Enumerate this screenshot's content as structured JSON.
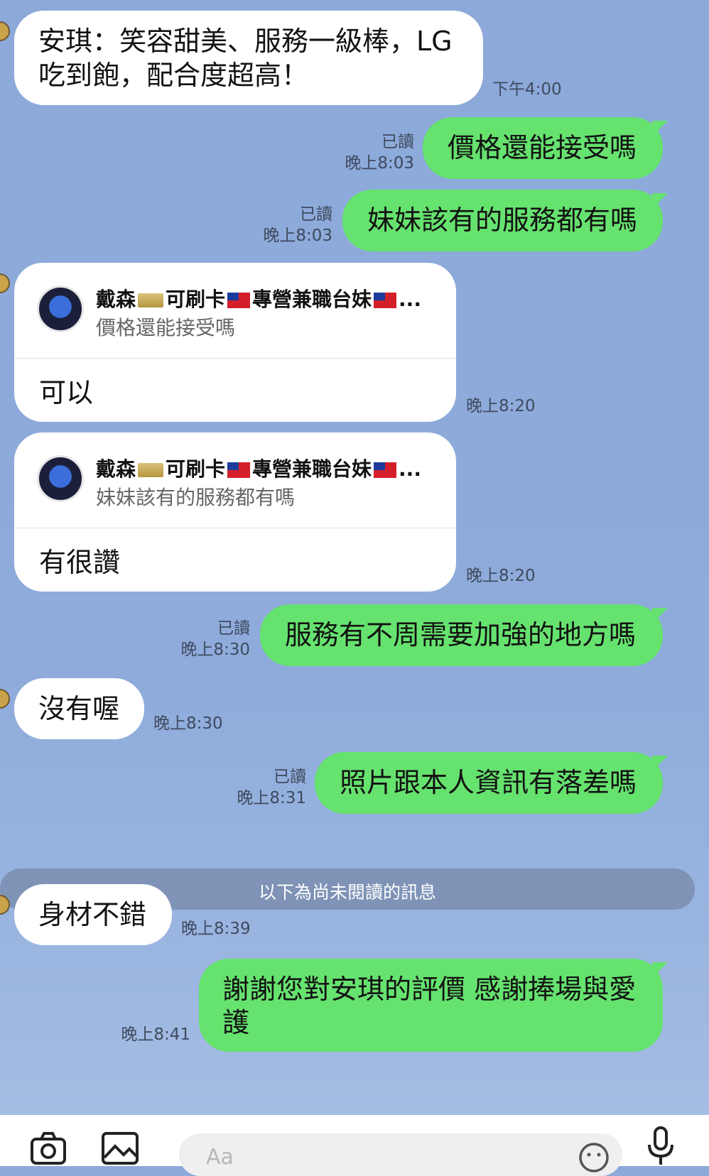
{
  "messages": [
    {
      "dir": "in",
      "text_lines": [
        "安琪：笑容甜美、服務一級棒，LG",
        "吃到飽，配合度超高！"
      ],
      "time": "下午4:00"
    },
    {
      "dir": "out",
      "text": "價格還能接受嗎",
      "read": "已讀",
      "time": "晚上8:03"
    },
    {
      "dir": "out",
      "text": "妹妹該有的服務都有嗎",
      "read": "已讀",
      "time": "晚上8:03"
    },
    {
      "dir": "in-reply",
      "reply_name": "戴森💳可刷卡🇹🇼專營兼職台妹🇹🇼...",
      "reply_quote": "價格還能接受嗎",
      "text": "可以",
      "time": "晚上8:20"
    },
    {
      "dir": "in-reply",
      "reply_name": "戴森💳可刷卡🇹🇼專營兼職台妹🇹🇼...",
      "reply_quote": "妹妹該有的服務都有嗎",
      "text": "有很讚",
      "time": "晚上8:20"
    },
    {
      "dir": "out",
      "text": "服務有不周需要加強的地方嗎",
      "read": "已讀",
      "time": "晚上8:30"
    },
    {
      "dir": "in",
      "text": "沒有喔",
      "time": "晚上8:30"
    },
    {
      "dir": "out",
      "text": "照片跟本人資訊有落差嗎",
      "read": "已讀",
      "time": "晚上8:31"
    },
    {
      "dir": "in",
      "text": "身材不錯",
      "time": "晚上8:39"
    },
    {
      "dir": "out",
      "text_lines": [
        "謝謝您對安琪的評價 感謝捧場與愛",
        "護"
      ],
      "time": "晚上8:41"
    }
  ],
  "unread_divider": "以下為尚未閱讀的訊息",
  "input": {
    "placeholder": "Aa"
  },
  "colors": {
    "background": "#8daadb",
    "outgoing_bubble": "#66e26f",
    "incoming_bubble": "#ffffff"
  },
  "icons": [
    "camera-icon",
    "image-icon",
    "emoji-icon",
    "microphone-icon"
  ]
}
